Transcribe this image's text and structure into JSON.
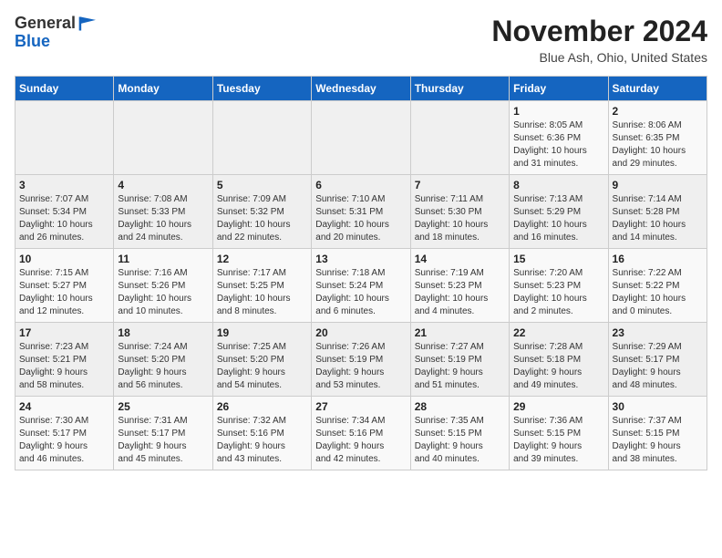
{
  "logo": {
    "general": "General",
    "blue": "Blue"
  },
  "header": {
    "month": "November 2024",
    "location": "Blue Ash, Ohio, United States"
  },
  "weekdays": [
    "Sunday",
    "Monday",
    "Tuesday",
    "Wednesday",
    "Thursday",
    "Friday",
    "Saturday"
  ],
  "weeks": [
    [
      {
        "day": "",
        "info": ""
      },
      {
        "day": "",
        "info": ""
      },
      {
        "day": "",
        "info": ""
      },
      {
        "day": "",
        "info": ""
      },
      {
        "day": "",
        "info": ""
      },
      {
        "day": "1",
        "info": "Sunrise: 8:05 AM\nSunset: 6:36 PM\nDaylight: 10 hours\nand 31 minutes."
      },
      {
        "day": "2",
        "info": "Sunrise: 8:06 AM\nSunset: 6:35 PM\nDaylight: 10 hours\nand 29 minutes."
      }
    ],
    [
      {
        "day": "3",
        "info": "Sunrise: 7:07 AM\nSunset: 5:34 PM\nDaylight: 10 hours\nand 26 minutes."
      },
      {
        "day": "4",
        "info": "Sunrise: 7:08 AM\nSunset: 5:33 PM\nDaylight: 10 hours\nand 24 minutes."
      },
      {
        "day": "5",
        "info": "Sunrise: 7:09 AM\nSunset: 5:32 PM\nDaylight: 10 hours\nand 22 minutes."
      },
      {
        "day": "6",
        "info": "Sunrise: 7:10 AM\nSunset: 5:31 PM\nDaylight: 10 hours\nand 20 minutes."
      },
      {
        "day": "7",
        "info": "Sunrise: 7:11 AM\nSunset: 5:30 PM\nDaylight: 10 hours\nand 18 minutes."
      },
      {
        "day": "8",
        "info": "Sunrise: 7:13 AM\nSunset: 5:29 PM\nDaylight: 10 hours\nand 16 minutes."
      },
      {
        "day": "9",
        "info": "Sunrise: 7:14 AM\nSunset: 5:28 PM\nDaylight: 10 hours\nand 14 minutes."
      }
    ],
    [
      {
        "day": "10",
        "info": "Sunrise: 7:15 AM\nSunset: 5:27 PM\nDaylight: 10 hours\nand 12 minutes."
      },
      {
        "day": "11",
        "info": "Sunrise: 7:16 AM\nSunset: 5:26 PM\nDaylight: 10 hours\nand 10 minutes."
      },
      {
        "day": "12",
        "info": "Sunrise: 7:17 AM\nSunset: 5:25 PM\nDaylight: 10 hours\nand 8 minutes."
      },
      {
        "day": "13",
        "info": "Sunrise: 7:18 AM\nSunset: 5:24 PM\nDaylight: 10 hours\nand 6 minutes."
      },
      {
        "day": "14",
        "info": "Sunrise: 7:19 AM\nSunset: 5:23 PM\nDaylight: 10 hours\nand 4 minutes."
      },
      {
        "day": "15",
        "info": "Sunrise: 7:20 AM\nSunset: 5:23 PM\nDaylight: 10 hours\nand 2 minutes."
      },
      {
        "day": "16",
        "info": "Sunrise: 7:22 AM\nSunset: 5:22 PM\nDaylight: 10 hours\nand 0 minutes."
      }
    ],
    [
      {
        "day": "17",
        "info": "Sunrise: 7:23 AM\nSunset: 5:21 PM\nDaylight: 9 hours\nand 58 minutes."
      },
      {
        "day": "18",
        "info": "Sunrise: 7:24 AM\nSunset: 5:20 PM\nDaylight: 9 hours\nand 56 minutes."
      },
      {
        "day": "19",
        "info": "Sunrise: 7:25 AM\nSunset: 5:20 PM\nDaylight: 9 hours\nand 54 minutes."
      },
      {
        "day": "20",
        "info": "Sunrise: 7:26 AM\nSunset: 5:19 PM\nDaylight: 9 hours\nand 53 minutes."
      },
      {
        "day": "21",
        "info": "Sunrise: 7:27 AM\nSunset: 5:19 PM\nDaylight: 9 hours\nand 51 minutes."
      },
      {
        "day": "22",
        "info": "Sunrise: 7:28 AM\nSunset: 5:18 PM\nDaylight: 9 hours\nand 49 minutes."
      },
      {
        "day": "23",
        "info": "Sunrise: 7:29 AM\nSunset: 5:17 PM\nDaylight: 9 hours\nand 48 minutes."
      }
    ],
    [
      {
        "day": "24",
        "info": "Sunrise: 7:30 AM\nSunset: 5:17 PM\nDaylight: 9 hours\nand 46 minutes."
      },
      {
        "day": "25",
        "info": "Sunrise: 7:31 AM\nSunset: 5:17 PM\nDaylight: 9 hours\nand 45 minutes."
      },
      {
        "day": "26",
        "info": "Sunrise: 7:32 AM\nSunset: 5:16 PM\nDaylight: 9 hours\nand 43 minutes."
      },
      {
        "day": "27",
        "info": "Sunrise: 7:34 AM\nSunset: 5:16 PM\nDaylight: 9 hours\nand 42 minutes."
      },
      {
        "day": "28",
        "info": "Sunrise: 7:35 AM\nSunset: 5:15 PM\nDaylight: 9 hours\nand 40 minutes."
      },
      {
        "day": "29",
        "info": "Sunrise: 7:36 AM\nSunset: 5:15 PM\nDaylight: 9 hours\nand 39 minutes."
      },
      {
        "day": "30",
        "info": "Sunrise: 7:37 AM\nSunset: 5:15 PM\nDaylight: 9 hours\nand 38 minutes."
      }
    ]
  ]
}
